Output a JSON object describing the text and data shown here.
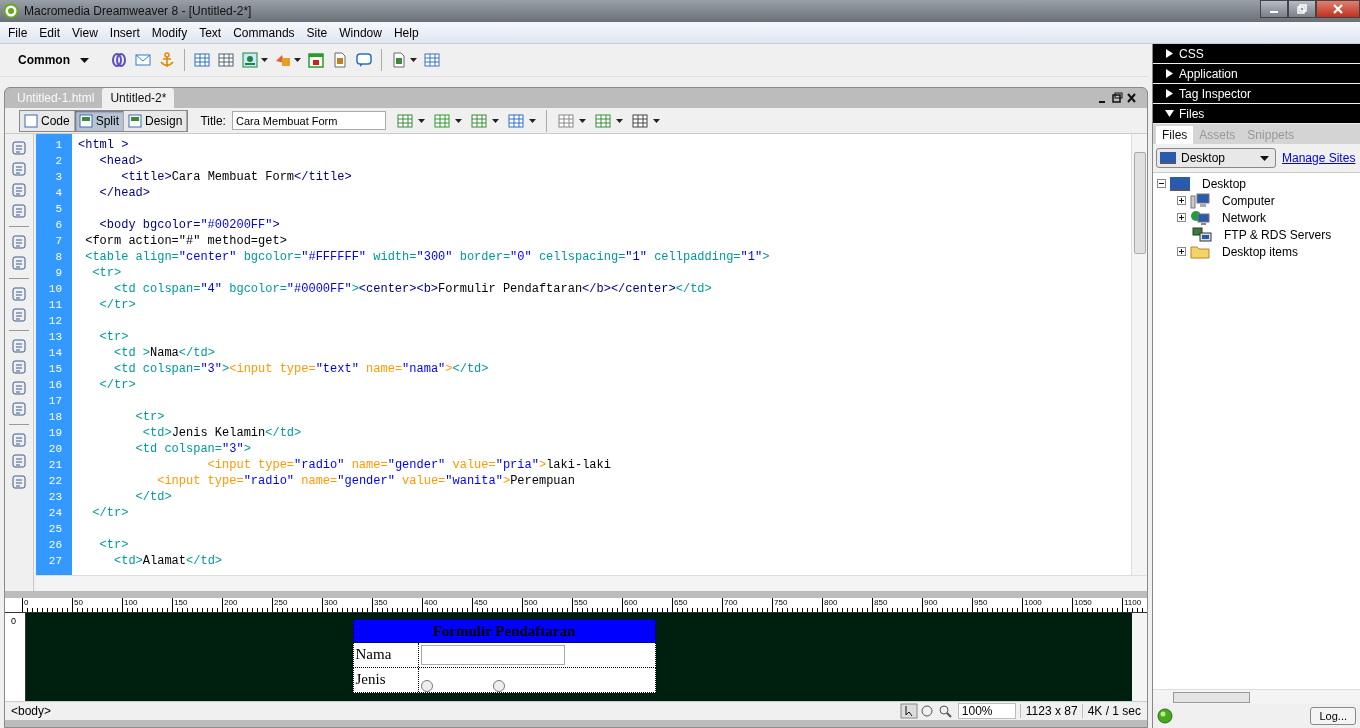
{
  "window": {
    "title": "Macromedia Dreamweaver 8 - [Untitled-2*]"
  },
  "menu": [
    "File",
    "Edit",
    "View",
    "Insert",
    "Modify",
    "Text",
    "Commands",
    "Site",
    "Window",
    "Help"
  ],
  "insert_bar": {
    "category": "Common"
  },
  "document_tabs": [
    {
      "label": "Untitled-1.html",
      "selected": false
    },
    {
      "label": "Untitled-2*",
      "selected": true
    }
  ],
  "view_buttons": [
    {
      "label": "Code",
      "selected": false
    },
    {
      "label": "Split",
      "selected": true
    },
    {
      "label": "Design",
      "selected": false
    }
  ],
  "title_field": {
    "label": "Title:",
    "value": "Cara Membuat Form"
  },
  "code_lines": [
    {
      "number": "1",
      "tokens": [
        {
          "kind": "tag",
          "text": "<html >"
        }
      ]
    },
    {
      "number": "2",
      "tokens": [
        {
          "kind": "tag",
          "text": "   <head>"
        }
      ]
    },
    {
      "number": "3",
      "tokens": [
        {
          "kind": "tag",
          "text": "      <title>"
        },
        {
          "kind": "text",
          "text": "Cara Membuat Form"
        },
        {
          "kind": "tag",
          "text": "</title>"
        }
      ]
    },
    {
      "number": "4",
      "tokens": [
        {
          "kind": "tag",
          "text": "   </head>"
        }
      ]
    },
    {
      "number": "5"
    },
    {
      "number": "6",
      "tokens": [
        {
          "kind": "tag",
          "text": "   <body bgcolor="
        },
        {
          "kind": "value",
          "text": "\"#00200FF\""
        },
        {
          "kind": "tag",
          "text": ">"
        }
      ]
    },
    {
      "number": "7",
      "tokens": [
        {
          "kind": "text",
          "text": " <form action=\"#\" method=get>"
        }
      ]
    },
    {
      "number": "8",
      "tokens": [
        {
          "kind": "table",
          "text": " <table align="
        },
        {
          "kind": "value",
          "text": "\"center\""
        },
        {
          "kind": "table",
          "text": " bgcolor="
        },
        {
          "kind": "value",
          "text": "\"#FFFFFF\""
        },
        {
          "kind": "table",
          "text": " width="
        },
        {
          "kind": "value",
          "text": "\"300\""
        },
        {
          "kind": "table",
          "text": " border="
        },
        {
          "kind": "value",
          "text": "\"0\""
        },
        {
          "kind": "table",
          "text": " cellspacing="
        },
        {
          "kind": "value",
          "text": "\"1\""
        },
        {
          "kind": "table",
          "text": " cellpadding="
        },
        {
          "kind": "value",
          "text": "\"1\""
        },
        {
          "kind": "table",
          "text": ">"
        }
      ]
    },
    {
      "number": "9",
      "tokens": [
        {
          "kind": "table",
          "text": "  <tr>"
        }
      ]
    },
    {
      "number": "10",
      "tokens": [
        {
          "kind": "table",
          "text": "     <td colspan="
        },
        {
          "kind": "value",
          "text": "\"4\""
        },
        {
          "kind": "table",
          "text": " bgcolor="
        },
        {
          "kind": "value",
          "text": "\"#0000FF\""
        },
        {
          "kind": "table",
          "text": ">"
        },
        {
          "kind": "tag",
          "text": "<center><b>"
        },
        {
          "kind": "text",
          "text": "Formulir Pendaftaran"
        },
        {
          "kind": "tag",
          "text": "</b></center>"
        },
        {
          "kind": "table",
          "text": "</td>"
        }
      ]
    },
    {
      "number": "11",
      "tokens": [
        {
          "kind": "table",
          "text": "   </tr>"
        }
      ]
    },
    {
      "number": "12"
    },
    {
      "number": "13",
      "tokens": [
        {
          "kind": "table",
          "text": "   <tr>"
        }
      ]
    },
    {
      "number": "14",
      "tokens": [
        {
          "kind": "table",
          "text": "     <td >"
        },
        {
          "kind": "text",
          "text": "Nama"
        },
        {
          "kind": "table",
          "text": "</td>"
        }
      ]
    },
    {
      "number": "15",
      "tokens": [
        {
          "kind": "table",
          "text": "     <td colspan="
        },
        {
          "kind": "value",
          "text": "\"3\""
        },
        {
          "kind": "table",
          "text": ">"
        },
        {
          "kind": "input",
          "text": "<input type="
        },
        {
          "kind": "value",
          "text": "\"text\""
        },
        {
          "kind": "input",
          "text": " name="
        },
        {
          "kind": "value",
          "text": "\"nama\""
        },
        {
          "kind": "input",
          "text": ">"
        },
        {
          "kind": "table",
          "text": "</td>"
        }
      ]
    },
    {
      "number": "16",
      "tokens": [
        {
          "kind": "table",
          "text": "   </tr>"
        }
      ]
    },
    {
      "number": "17"
    },
    {
      "number": "18",
      "tokens": [
        {
          "kind": "table",
          "text": "        <tr>"
        }
      ]
    },
    {
      "number": "19",
      "tokens": [
        {
          "kind": "table",
          "text": "         <td>"
        },
        {
          "kind": "text",
          "text": "Jenis Kelamin"
        },
        {
          "kind": "table",
          "text": "</td>"
        }
      ]
    },
    {
      "number": "20",
      "tokens": [
        {
          "kind": "table",
          "text": "        <td colspan="
        },
        {
          "kind": "value",
          "text": "\"3\""
        },
        {
          "kind": "table",
          "text": ">"
        }
      ]
    },
    {
      "number": "21",
      "tokens": [
        {
          "kind": "input",
          "text": "                  <input type="
        },
        {
          "kind": "value",
          "text": "\"radio\""
        },
        {
          "kind": "input",
          "text": " name="
        },
        {
          "kind": "value",
          "text": "\"gender\""
        },
        {
          "kind": "input",
          "text": " value="
        },
        {
          "kind": "value",
          "text": "\"pria\""
        },
        {
          "kind": "input",
          "text": ">"
        },
        {
          "kind": "text",
          "text": "laki-laki"
        }
      ]
    },
    {
      "number": "22",
      "tokens": [
        {
          "kind": "input",
          "text": "           <input type="
        },
        {
          "kind": "value",
          "text": "\"radio\""
        },
        {
          "kind": "input",
          "text": " name="
        },
        {
          "kind": "value",
          "text": "\"gender\""
        },
        {
          "kind": "input",
          "text": " value="
        },
        {
          "kind": "value",
          "text": "\"wanita\""
        },
        {
          "kind": "input",
          "text": ">"
        },
        {
          "kind": "text",
          "text": "Perempuan"
        }
      ]
    },
    {
      "number": "23",
      "tokens": [
        {
          "kind": "table",
          "text": "        </td>"
        }
      ]
    },
    {
      "number": "24",
      "tokens": [
        {
          "kind": "table",
          "text": "  </tr>"
        }
      ]
    },
    {
      "number": "25"
    },
    {
      "number": "26",
      "tokens": [
        {
          "kind": "table",
          "text": "   <tr>"
        }
      ]
    },
    {
      "number": "27",
      "tokens": [
        {
          "kind": "table",
          "text": "     <td>"
        },
        {
          "kind": "text",
          "text": "Alamat"
        },
        {
          "kind": "table",
          "text": "</td>"
        }
      ]
    }
  ],
  "ruler": {
    "labels": [
      "0",
      "50",
      "100",
      "150",
      "200",
      "250",
      "300",
      "350",
      "400",
      "450",
      "500",
      "550",
      "600",
      "650",
      "700",
      "750",
      "800",
      "850",
      "900",
      "950",
      "1000",
      "1050",
      "1100"
    ],
    "vertical_label": "0"
  },
  "design_view": {
    "heading": "Formulir Pendaftaran",
    "rows": [
      {
        "label": "Nama",
        "kind": "text"
      },
      {
        "label": "Jenis",
        "kind": "radio",
        "options": [
          {
            "checked": false
          },
          {
            "checked": false
          }
        ]
      }
    ]
  },
  "status_bar": {
    "tag": "<body>",
    "zoom": "100%",
    "size": "1123 x 87",
    "download": "4K / 1 sec"
  },
  "panel_groups": [
    {
      "label": "CSS",
      "expanded": false
    },
    {
      "label": "Application",
      "expanded": false
    },
    {
      "label": "Tag Inspector",
      "expanded": false
    },
    {
      "label": "Files",
      "expanded": true
    }
  ],
  "files_panel": {
    "tabs": [
      {
        "label": "Files",
        "selected": true
      },
      {
        "label": "Assets",
        "selected": false
      },
      {
        "label": "Snippets",
        "selected": false
      }
    ],
    "site": "Desktop",
    "manage_link": "Manage Sites",
    "tree": [
      {
        "label": "Desktop",
        "expanded": true,
        "kind": "desktop",
        "children": [
          {
            "label": "Computer",
            "expanded": false,
            "kind": "computer"
          },
          {
            "label": "Network",
            "expanded": false,
            "kind": "network"
          },
          {
            "label": "FTP & RDS Servers",
            "kind": "server"
          },
          {
            "label": "Desktop items",
            "expanded": false,
            "kind": "folder"
          }
        ]
      }
    ],
    "log_button": "Log..."
  }
}
